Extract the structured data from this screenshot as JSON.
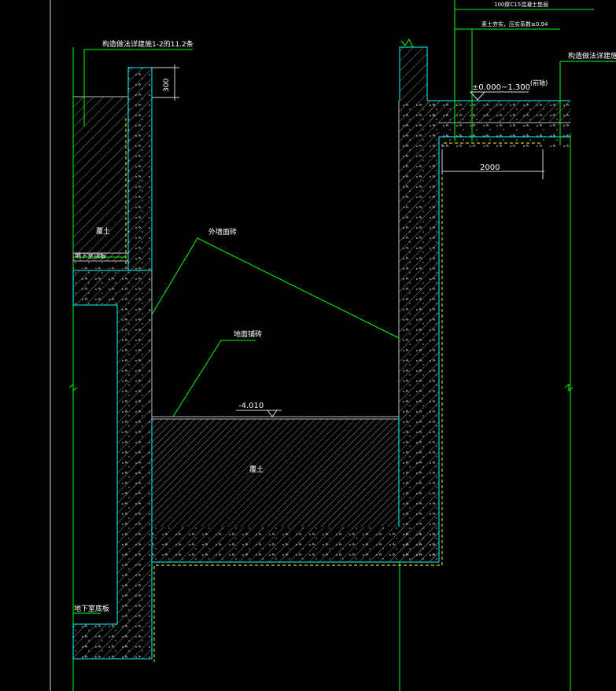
{
  "labels": {
    "spec_top_1": "100厚C15混凝土垫层",
    "spec_top_2": "素土夯实，压实系数≥0.94",
    "construction_note_left": "构造做法详建施1-2的11.2条",
    "construction_note_right": "构造做法详建施",
    "dim_300": "300",
    "elevation_top": "±0.000~1.300",
    "elevation_top_suffix": "(前轴)",
    "dim_2000": "2000",
    "fill_upper": "覆土",
    "basement_roof": "地下室顶板",
    "outer_wall_finish": "外墙面砖",
    "floor_finish": "地面铺砖",
    "elevation_floor": "-4.010",
    "fill_lower": "覆土",
    "basement_floor": "地下室底板"
  },
  "colors": {
    "background": "#000000",
    "outline": "#00ffff",
    "hatch": "#9a9a9a",
    "leader": "#00ff00",
    "text": "#ffffff",
    "dimension": "#ffff00"
  }
}
